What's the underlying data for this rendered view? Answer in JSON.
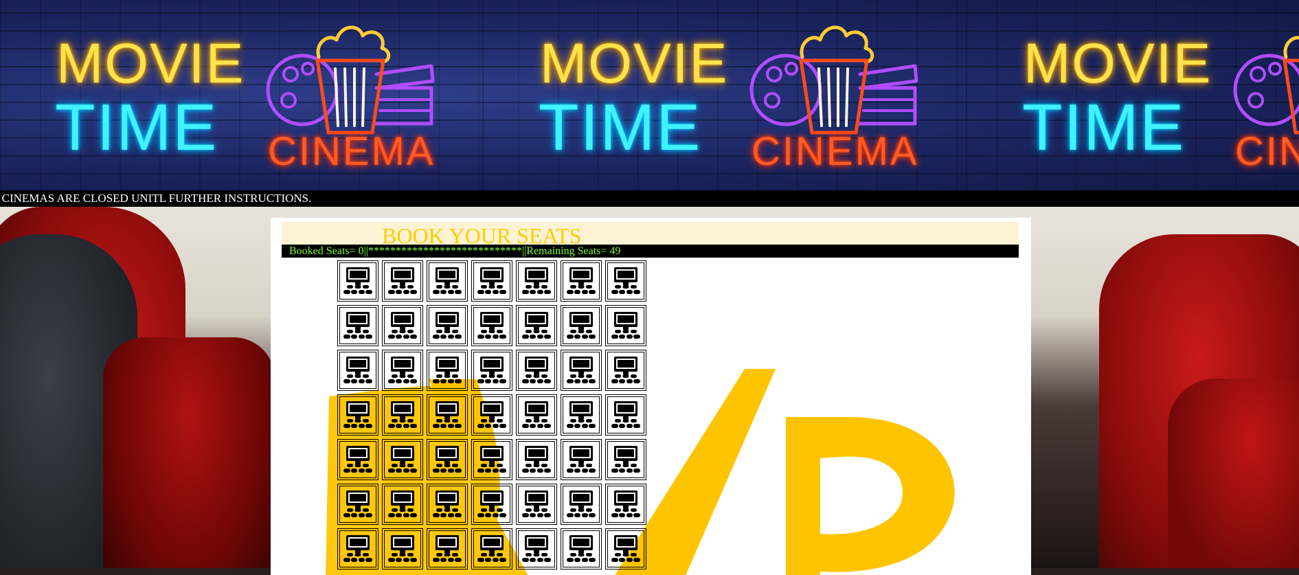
{
  "banner": {
    "tiles": [
      {
        "movie": "MOVIE",
        "time": "TIME",
        "cinema": "CINEMA"
      },
      {
        "movie": "MOVIE",
        "time": "TIME",
        "cinema": "CINEMA"
      },
      {
        "movie": "MOVIE",
        "time": "TIME",
        "cinema": "CINEMA"
      }
    ]
  },
  "notice": {
    "text": "E CINEMAS ARE CLOSED UNITL FURTHER INSTRUCTIONS."
  },
  "booking": {
    "title": "BOOK YOUR SEATS",
    "status_text": "Booked Seats= 0||****************************||Remaining Seats= 49",
    "rows": 7,
    "columns": 7,
    "seat_icon": "cinema-seat-icon"
  },
  "colors": {
    "title": "#ffcc00",
    "status_text": "#7cff2a",
    "status_bg": "#000000",
    "watermark": "#ffc400"
  }
}
